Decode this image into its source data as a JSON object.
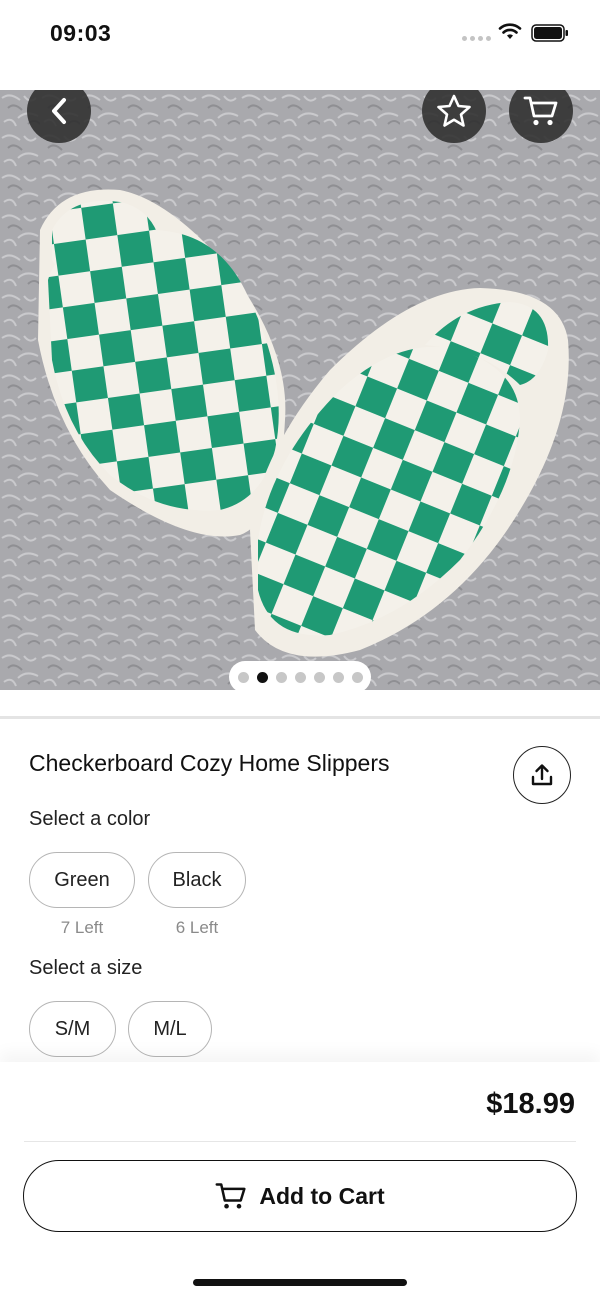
{
  "status_bar": {
    "time": "09:03"
  },
  "gallery": {
    "page_count": 7,
    "active_page": 2
  },
  "product": {
    "title": "Checkerboard Cozy Home Slippers",
    "color_label": "Select a color",
    "colors": [
      {
        "name": "Green",
        "stock": "7 Left"
      },
      {
        "name": "Black",
        "stock": "6 Left"
      }
    ],
    "size_label": "Select a size",
    "sizes": [
      "S/M",
      "M/L"
    ]
  },
  "checkout": {
    "price": "$18.99",
    "add_to_cart_label": "Add to Cart"
  },
  "icons": {
    "back": "chevron-left-icon",
    "favorite": "star-icon",
    "cart": "cart-icon",
    "share": "share-icon"
  },
  "colors": {
    "product_green": "#1f9a74",
    "overlay_button": "#2d2d2d"
  }
}
